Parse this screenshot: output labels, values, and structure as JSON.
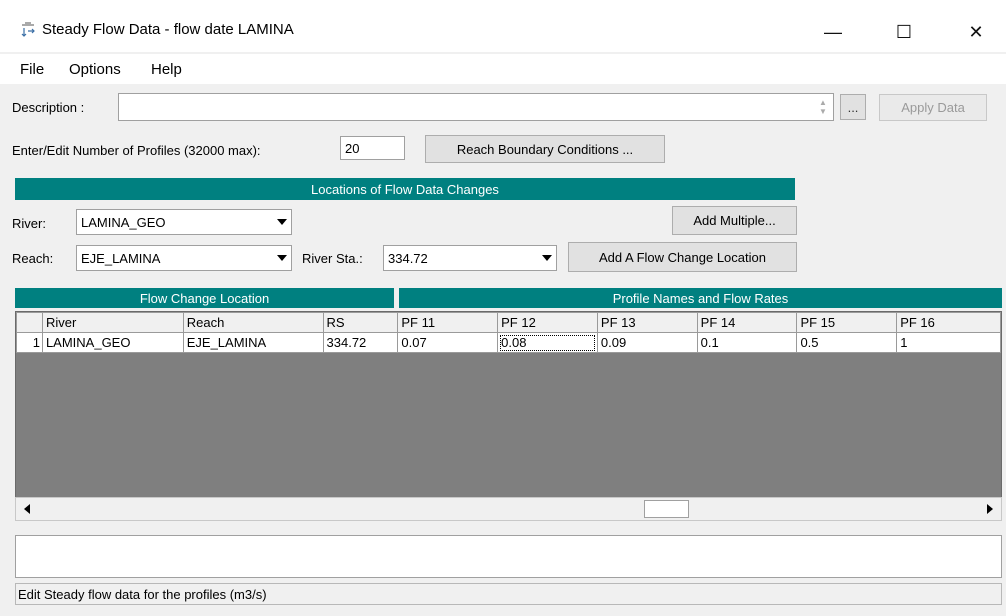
{
  "window": {
    "title": "Steady Flow Data - flow date LAMINA",
    "minimize": "—",
    "maximize": "☐",
    "close": "✕"
  },
  "menu": [
    "File",
    "Options",
    "Help"
  ],
  "description": {
    "label": "Description :",
    "value": "",
    "ellipsis": "...",
    "apply_button": "Apply Data"
  },
  "profiles": {
    "label": "Enter/Edit Number of Profiles (32000 max):",
    "value": "20",
    "reach_bc_button": "Reach Boundary Conditions ..."
  },
  "locations": {
    "header": "Locations of Flow Data Changes",
    "river_label": "River:",
    "river_value": "LAMINA_GEO",
    "reach_label": "Reach:",
    "reach_value": "EJE_LAMINA",
    "river_sta_label": "River Sta.:",
    "river_sta_value": "334.72",
    "add_multiple_button": "Add Multiple...",
    "add_flow_change_button": "Add A Flow Change Location"
  },
  "grid": {
    "flow_change_header": "Flow Change Location",
    "profile_header": "Profile Names and Flow Rates",
    "columns": [
      "River",
      "Reach",
      "RS",
      "PF 11",
      "PF 12",
      "PF 13",
      "PF 14",
      "PF 15",
      "PF 16"
    ],
    "rows": [
      {
        "num": "1",
        "cells": [
          "LAMINA_GEO",
          "EJE_LAMINA",
          "334.72",
          "0.07",
          "0.08",
          "0.09",
          "0.1",
          "0.5",
          "1"
        ]
      }
    ]
  },
  "status": "Edit Steady flow data for the profiles (m3/s)",
  "icons": {
    "app": "flow-data-icon",
    "scroll_left": "scroll-left-icon",
    "scroll_right": "scroll-right-icon",
    "spin": "spin-updown-icon",
    "dropdown": "chevron-down-icon"
  },
  "colors": {
    "header_teal": "#008080",
    "grid_background": "#7f7f7f"
  }
}
